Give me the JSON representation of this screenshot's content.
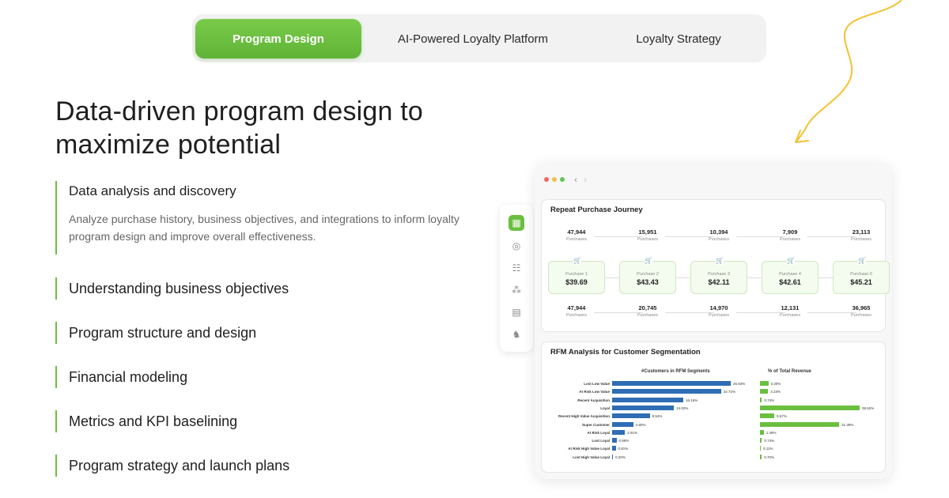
{
  "tabs": [
    {
      "label": "Program Design",
      "active": true
    },
    {
      "label": "AI-Powered Loyalty Platform",
      "active": false
    },
    {
      "label": "Loyalty Strategy",
      "active": false
    }
  ],
  "headline": "Data-driven program design to maximize potential",
  "features": [
    {
      "title": "Data analysis and discovery",
      "description": "Analyze purchase history, business objectives, and integrations to inform loyalty program design and improve overall effectiveness."
    },
    {
      "title": "Understanding business objectives"
    },
    {
      "title": "Program structure and design"
    },
    {
      "title": "Financial modeling"
    },
    {
      "title": "Metrics and KPI baselining"
    },
    {
      "title": "Program strategy and launch plans"
    }
  ],
  "colors": {
    "accent": "#6bbf3f",
    "bar_blue": "#2f6db5",
    "arrow": "#f2c230"
  },
  "sidebar_icons": [
    "dashboard-icon",
    "target-icon",
    "hierarchy-icon",
    "analytics-icon",
    "report-icon",
    "chess-icon"
  ],
  "dashboard": {
    "journey": {
      "title": "Repeat Purchase Journey",
      "top_row": [
        {
          "value": "47,944",
          "label": "Purchases"
        },
        {
          "value": "15,951",
          "label": "Purchases"
        },
        {
          "value": "10,394",
          "label": "Purchases"
        },
        {
          "value": "7,909",
          "label": "Purchases"
        },
        {
          "value": "23,113",
          "label": "Purchases"
        }
      ],
      "purchases": [
        {
          "label": "Purchase 1",
          "price": "$39.69"
        },
        {
          "label": "Purchase 2",
          "price": "$43.43"
        },
        {
          "label": "Purchase 3",
          "price": "$42.11"
        },
        {
          "label": "Purchase 4",
          "price": "$42.61"
        },
        {
          "label": "Purchase 5",
          "price": "$45.21"
        }
      ],
      "bottom_row": [
        {
          "value": "47,944",
          "label": "Purchases"
        },
        {
          "value": "20,745",
          "label": "Purchases"
        },
        {
          "value": "14,970",
          "label": "Purchases"
        },
        {
          "value": "12,131",
          "label": "Purchases"
        },
        {
          "value": "36,965",
          "label": "Purchases"
        }
      ]
    },
    "rfm": {
      "title": "RFM Analysis for Customer Segmentation",
      "customers_header": "#Customers in RFM Segments",
      "revenue_header": "% of Total Revenue",
      "segments": [
        "Lost Low Value",
        "At Risk Low Value",
        "Recent Acquisition",
        "Loyal",
        "Recent High Value Acquisition",
        "Super Customer",
        "At Risk Loyal",
        "Lost Loyal",
        "At Risk High Value Loyal",
        "Lost High Value Loyal"
      ],
      "customers_pct": [
        26.93,
        24.72,
        16.16,
        14.02,
        8.54,
        4.8,
        2.91,
        0.99,
        0.81,
        0.2
      ],
      "customers_labels": [
        "26.93%",
        "24.72%",
        "16.16%",
        "14.02%",
        "8.54%",
        "4.80%",
        "2.91%",
        "0.99%",
        "0.81%",
        "0.20%"
      ],
      "revenue_pct": [
        3.3,
        3.23,
        0.74,
        39.52,
        5.67,
        31.39,
        1.49,
        0.74,
        0.11,
        0.7
      ],
      "revenue_labels": [
        "3.30%",
        "3.23%",
        "0.74%",
        "39.52%",
        "5.67%",
        "31.39%",
        "1.49%",
        "0.74%",
        "0.11%",
        "0.70%"
      ]
    }
  }
}
